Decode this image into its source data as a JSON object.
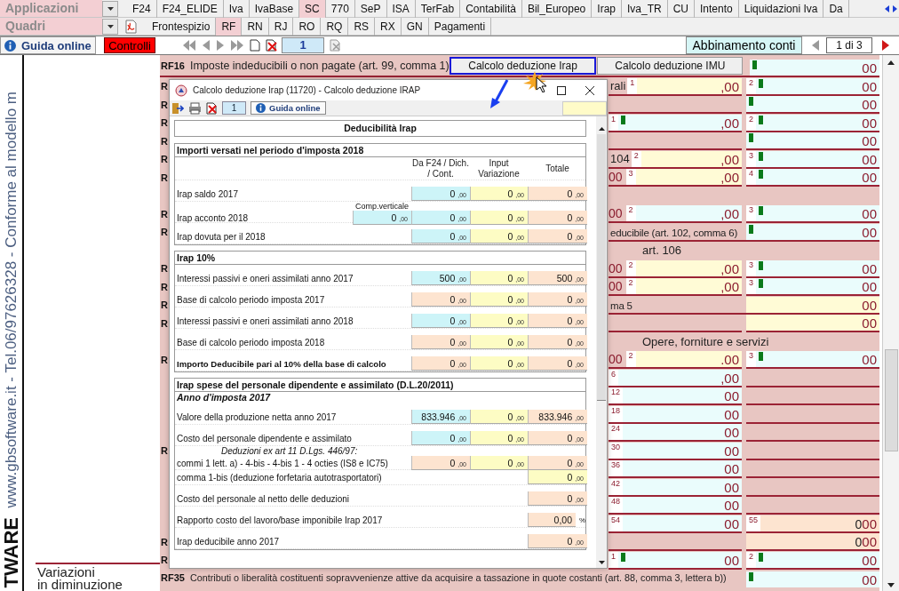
{
  "menu": {
    "label": "Applicazioni",
    "tabs": [
      {
        "label": "F24",
        "selected": false
      },
      {
        "label": "F24_ELIDE",
        "selected": false
      },
      {
        "label": "Iva",
        "selected": false
      },
      {
        "label": "IvaBase",
        "selected": false
      },
      {
        "label": "SC",
        "selected": true
      },
      {
        "label": "770",
        "selected": false
      },
      {
        "label": "SeP",
        "selected": false
      },
      {
        "label": "ISA",
        "selected": false
      },
      {
        "label": "TerFab",
        "selected": false
      },
      {
        "label": "Contabilità",
        "selected": false
      },
      {
        "label": "Bil_Europeo",
        "selected": false
      },
      {
        "label": "Irap",
        "selected": false
      },
      {
        "label": "Iva_TR",
        "selected": false
      },
      {
        "label": "CU",
        "selected": false
      },
      {
        "label": "Intento",
        "selected": false
      },
      {
        "label": "Liquidazioni Iva",
        "selected": false
      },
      {
        "label": "Da",
        "selected": false
      }
    ]
  },
  "quadri": {
    "label": "Quadri",
    "tabs": [
      {
        "label": "Frontespizio",
        "selected": false
      },
      {
        "label": "RF",
        "selected": true
      },
      {
        "label": "RN",
        "selected": false
      },
      {
        "label": "RJ",
        "selected": false
      },
      {
        "label": "RO",
        "selected": false
      },
      {
        "label": "RQ",
        "selected": false
      },
      {
        "label": "RS",
        "selected": false
      },
      {
        "label": "RX",
        "selected": false
      },
      {
        "label": "GN",
        "selected": false
      },
      {
        "label": "Pagamenti",
        "selected": false
      }
    ]
  },
  "toolbar": {
    "help": "Guida online",
    "checks": "Controlli",
    "page": "1",
    "accounts": "Abbinamento conti",
    "pager": "1 di 3"
  },
  "side": {
    "slogan": "www.gbsoftware.it - Tel.06/97626328 - Conforme al modello m",
    "brand": "TWARE",
    "caption": [
      "Variazioni",
      "in diminuzione"
    ]
  },
  "form": {
    "rows": [
      {
        "kind": "section",
        "code": "RF16",
        "label": "Imposte indeducibili o non pagate (art. 99, comma 1)",
        "buttons": [
          {
            "label": "Calcolo deduzione Irap",
            "selected": true
          },
          {
            "label": "Calcolo deduzione IMU",
            "selected": false
          }
        ],
        "right": {
          "cents": "00",
          "kind": "computed",
          "flag": true
        }
      },
      {
        "kind": "line",
        "code": "R",
        "label": "rali",
        "left": {
          "number": "1",
          "cents": ",00",
          "kind": "editable",
          "flag": false
        },
        "right": {
          "number": "2",
          "cents": "00",
          "kind": "computed",
          "flag": true
        }
      },
      {
        "kind": "line",
        "code": "R",
        "right": {
          "cents": "00",
          "kind": "computed",
          "flag": true
        }
      },
      {
        "kind": "line",
        "code": "R",
        "left": {
          "number": "1",
          "cents": ",00",
          "kind": "computed",
          "flag": true
        },
        "right": {
          "number": "2",
          "cents": "00",
          "kind": "computed",
          "flag": true
        }
      },
      {
        "kind": "line",
        "code": "R",
        "right": {
          "cents": "00",
          "kind": "computed",
          "flag": true
        }
      },
      {
        "kind": "line",
        "code": "R",
        "label": "104",
        "left": {
          "number": "2",
          "cents": ",00",
          "kind": "editable",
          "flag": false
        },
        "right": {
          "number": "3",
          "cents": "00",
          "kind": "computed",
          "flag": true
        }
      },
      {
        "kind": "line",
        "code": "R",
        "tail": "00",
        "left": {
          "number": "3",
          "cents": ",00",
          "kind": "editable",
          "flag": false
        },
        "right": {
          "number": "4",
          "cents": "00",
          "kind": "computed",
          "flag": true
        }
      },
      {
        "kind": "blank"
      },
      {
        "kind": "line",
        "code": "R",
        "tail": "00",
        "left": {
          "number": "2",
          "cents": ",00",
          "kind": "computed",
          "flag": false
        },
        "right": {
          "number": "3",
          "cents": "00",
          "kind": "computed",
          "flag": true
        }
      },
      {
        "kind": "line",
        "code": "R",
        "label": "educibile (art. 102, comma 6)",
        "right": {
          "cents": "00",
          "kind": "computed",
          "flag": true
        }
      },
      {
        "kind": "heading",
        "label": "art. 106"
      },
      {
        "kind": "line",
        "code": "R",
        "tail": "00",
        "left": {
          "number": "2",
          "cents": ",00",
          "kind": "editable",
          "flag": false
        },
        "right": {
          "number": "3",
          "cents": "00",
          "kind": "computed",
          "flag": true
        }
      },
      {
        "kind": "line",
        "code": "R",
        "tail": "00",
        "left": {
          "number": "2",
          "cents": ",00",
          "kind": "editable",
          "flag": false
        },
        "right": {
          "number": "3",
          "cents": "00",
          "kind": "computed",
          "flag": true
        }
      },
      {
        "kind": "line",
        "code": "R",
        "label": "ma 5",
        "right": {
          "cents": "00",
          "kind": "editable",
          "flag": false
        }
      },
      {
        "kind": "line",
        "code": "R",
        "right": {
          "cents": "00",
          "kind": "editable",
          "flag": false
        }
      },
      {
        "kind": "heading",
        "label": "Opere, forniture e servizi"
      },
      {
        "kind": "line",
        "code": "R",
        "tail": "00",
        "left": {
          "number": "2",
          "cents": ".00",
          "kind": "editable",
          "flag": false
        },
        "right": {
          "number": "3",
          "cents": "00",
          "kind": "computed",
          "flag": true
        }
      },
      {
        "kind": "line",
        "left": {
          "number": "6",
          "cents": ",00",
          "kind": "computed",
          "flag": false
        }
      },
      {
        "kind": "line",
        "left": {
          "number": "12",
          "cents": "00",
          "kind": "computed",
          "flag": false
        }
      },
      {
        "kind": "line",
        "left": {
          "number": "18",
          "cents": "00",
          "kind": "computed",
          "flag": false
        }
      },
      {
        "kind": "line",
        "left": {
          "number": "24",
          "cents": "00",
          "kind": "computed",
          "flag": false
        }
      },
      {
        "kind": "line",
        "code": "R",
        "left": {
          "number": "30",
          "cents": "00",
          "kind": "computed",
          "flag": false
        }
      },
      {
        "kind": "line",
        "left": {
          "number": "36",
          "cents": "00",
          "kind": "computed",
          "flag": false
        }
      },
      {
        "kind": "line",
        "left": {
          "number": "42",
          "cents": "00",
          "kind": "computed",
          "flag": false
        }
      },
      {
        "kind": "line",
        "left": {
          "number": "48",
          "cents": "00",
          "kind": "computed",
          "flag": false
        }
      },
      {
        "kind": "line",
        "left": {
          "number": "54",
          "cents": "00",
          "kind": "computed",
          "flag": false
        },
        "right": {
          "number": "55",
          "value": "0",
          "cents": "00",
          "kind": "total",
          "flag": false
        }
      },
      {
        "kind": "line",
        "code": "R",
        "right": {
          "value": "0",
          "cents": "00",
          "kind": "total",
          "flag": false
        }
      },
      {
        "kind": "line",
        "code": "R",
        "left": {
          "number": "1",
          "cents": "00",
          "kind": "computed",
          "flag": true
        },
        "right": {
          "number": "2",
          "cents": "00",
          "kind": "computed",
          "flag": true
        }
      },
      {
        "kind": "section",
        "code": "RF35",
        "label": "Contributi o liberalità costituenti sopravvenienze attive da acquisire a tassazione in quote costanti (art. 88, comma 3, lettera b))",
        "right": {
          "cents": "00",
          "kind": "computed",
          "flag": true
        }
      }
    ]
  },
  "dialog": {
    "title": "Calcolo deduzione Irap (11720) - Calcolo deduzione IRAP",
    "page": "1",
    "help": "Guida online",
    "heading": "Deducibilità Irap",
    "sections": [
      {
        "title": "Importi versati nel periodo d'imposta 2018",
        "rows": [
          {
            "kind": "columns",
            "labels": [
              "Da F24 / Dich. / Cont.",
              "Input Variazione",
              "Totale"
            ]
          },
          {
            "kind": "triple",
            "label": "Irap saldo 2017",
            "bold": false,
            "cells": [
              {
                "value": "0",
                "cents": ",00",
                "kind": "imported"
              },
              {
                "value": "0",
                "cents": ",00",
                "kind": "input"
              },
              {
                "value": "0",
                "cents": ",00",
                "kind": "total"
              }
            ]
          },
          {
            "kind": "triple",
            "label": "Irap acconto 2018",
            "bold": false,
            "extra": {
              "caption": "Comp.verticale",
              "value": "0",
              "cents": ",00",
              "kind": "imported"
            },
            "cells": [
              {
                "value": "0",
                "cents": ",00",
                "kind": "imported"
              },
              {
                "value": "0",
                "cents": ",00",
                "kind": "input"
              },
              {
                "value": "0",
                "cents": ",00",
                "kind": "total"
              }
            ]
          },
          {
            "kind": "triple",
            "label": "Irap dovuta per il 2018",
            "bold": false,
            "cells": [
              {
                "value": "0",
                "cents": ",00",
                "kind": "imported"
              },
              {
                "value": "0",
                "cents": ",00",
                "kind": "input"
              },
              {
                "value": "0",
                "cents": ",00",
                "kind": "total"
              }
            ]
          }
        ]
      },
      {
        "title": "Irap 10%",
        "rows": [
          {
            "kind": "triple",
            "label": "Interessi passivi e oneri assimilati anno 2017",
            "bold": false,
            "cells": [
              {
                "value": "500",
                "cents": ",00",
                "kind": "imported"
              },
              {
                "value": "0",
                "cents": ",00",
                "kind": "input"
              },
              {
                "value": "500",
                "cents": ",00",
                "kind": "total"
              }
            ]
          },
          {
            "kind": "triple",
            "label": "Base di calcolo periodo imposta 2017",
            "bold": false,
            "cells": [
              {
                "value": "0",
                "cents": ",00",
                "kind": "total"
              },
              {
                "value": "0",
                "cents": ",00",
                "kind": "input"
              },
              {
                "value": "0",
                "cents": ",00",
                "kind": "total"
              }
            ]
          },
          {
            "kind": "triple",
            "label": "Interessi passivi e oneri assimilati anno 2018",
            "bold": false,
            "cells": [
              {
                "value": "0",
                "cents": ",00",
                "kind": "imported"
              },
              {
                "value": "0",
                "cents": ",00",
                "kind": "input"
              },
              {
                "value": "0",
                "cents": ",00",
                "kind": "total"
              }
            ]
          },
          {
            "kind": "triple",
            "label": "Base di calcolo periodo imposta 2018",
            "bold": false,
            "cells": [
              {
                "value": "0",
                "cents": ",00",
                "kind": "total"
              },
              {
                "value": "0",
                "cents": ",00",
                "kind": "input"
              },
              {
                "value": "0",
                "cents": ",00",
                "kind": "total"
              }
            ]
          },
          {
            "kind": "triple",
            "label": "Importo Deducibile pari al 10% della base di calcolo",
            "bold": true,
            "cells": [
              {
                "value": "0",
                "cents": ",00",
                "kind": "total"
              },
              {
                "value": "0",
                "cents": ",00",
                "kind": "input"
              },
              {
                "value": "0",
                "cents": ",00",
                "kind": "total"
              }
            ]
          }
        ]
      },
      {
        "title": "Irap spese del personale dipendente e assimilato (D.L.20/2011)",
        "subtitle": "Anno d'imposta 2017",
        "rows": [
          {
            "kind": "triple",
            "label": "Valore della produzione netta anno 2017",
            "bold": false,
            "cells": [
              {
                "value": "833.946",
                "cents": ",00",
                "kind": "imported"
              },
              {
                "value": "0",
                "cents": ",00",
                "kind": "input"
              },
              {
                "value": "833.946",
                "cents": ",00",
                "kind": "total"
              }
            ]
          },
          {
            "kind": "triple",
            "label": "Costo del personale dipendente e assimilato",
            "bold": false,
            "cells": [
              {
                "value": "0",
                "cents": ",00",
                "kind": "imported"
              },
              {
                "value": "0",
                "cents": ",00",
                "kind": "input"
              },
              {
                "value": "0",
                "cents": ",00",
                "kind": "total"
              }
            ]
          },
          {
            "kind": "note",
            "label": "Deduzioni ex art 11 D.Lgs. 446/97:"
          },
          {
            "kind": "triple",
            "label": "commi 1 lett. a) - 4-bis - 4-bis 1 - 4 octies (IS8 e IC75)",
            "bold": false,
            "cells": [
              {
                "value": "0",
                "cents": ",00",
                "kind": "total"
              },
              {
                "value": "0",
                "cents": ",00",
                "kind": "input"
              },
              {
                "value": "0",
                "cents": ",00",
                "kind": "total"
              }
            ]
          },
          {
            "kind": "single",
            "label": "comma 1-bis (deduzione forfetaria autotrasportatori)",
            "bold": false,
            "cells": [
              {
                "value": "0",
                "cents": ",00",
                "kind": "input"
              }
            ]
          },
          {
            "kind": "single",
            "label": "Costo del personale al netto delle deduzioni",
            "bold": false,
            "cells": [
              {
                "value": "0",
                "cents": ",00",
                "kind": "total"
              }
            ]
          },
          {
            "kind": "single",
            "label": "Rapporto costo del lavoro/base imponibile Irap 2017",
            "bold": false,
            "cells": [
              {
                "value": "0,00",
                "unit": "%",
                "kind": "total"
              }
            ]
          },
          {
            "kind": "single",
            "label": "Irap deducibile anno 2017",
            "bold": false,
            "cells": [
              {
                "value": "0",
                "cents": ",00",
                "kind": "total"
              }
            ]
          }
        ]
      }
    ]
  }
}
